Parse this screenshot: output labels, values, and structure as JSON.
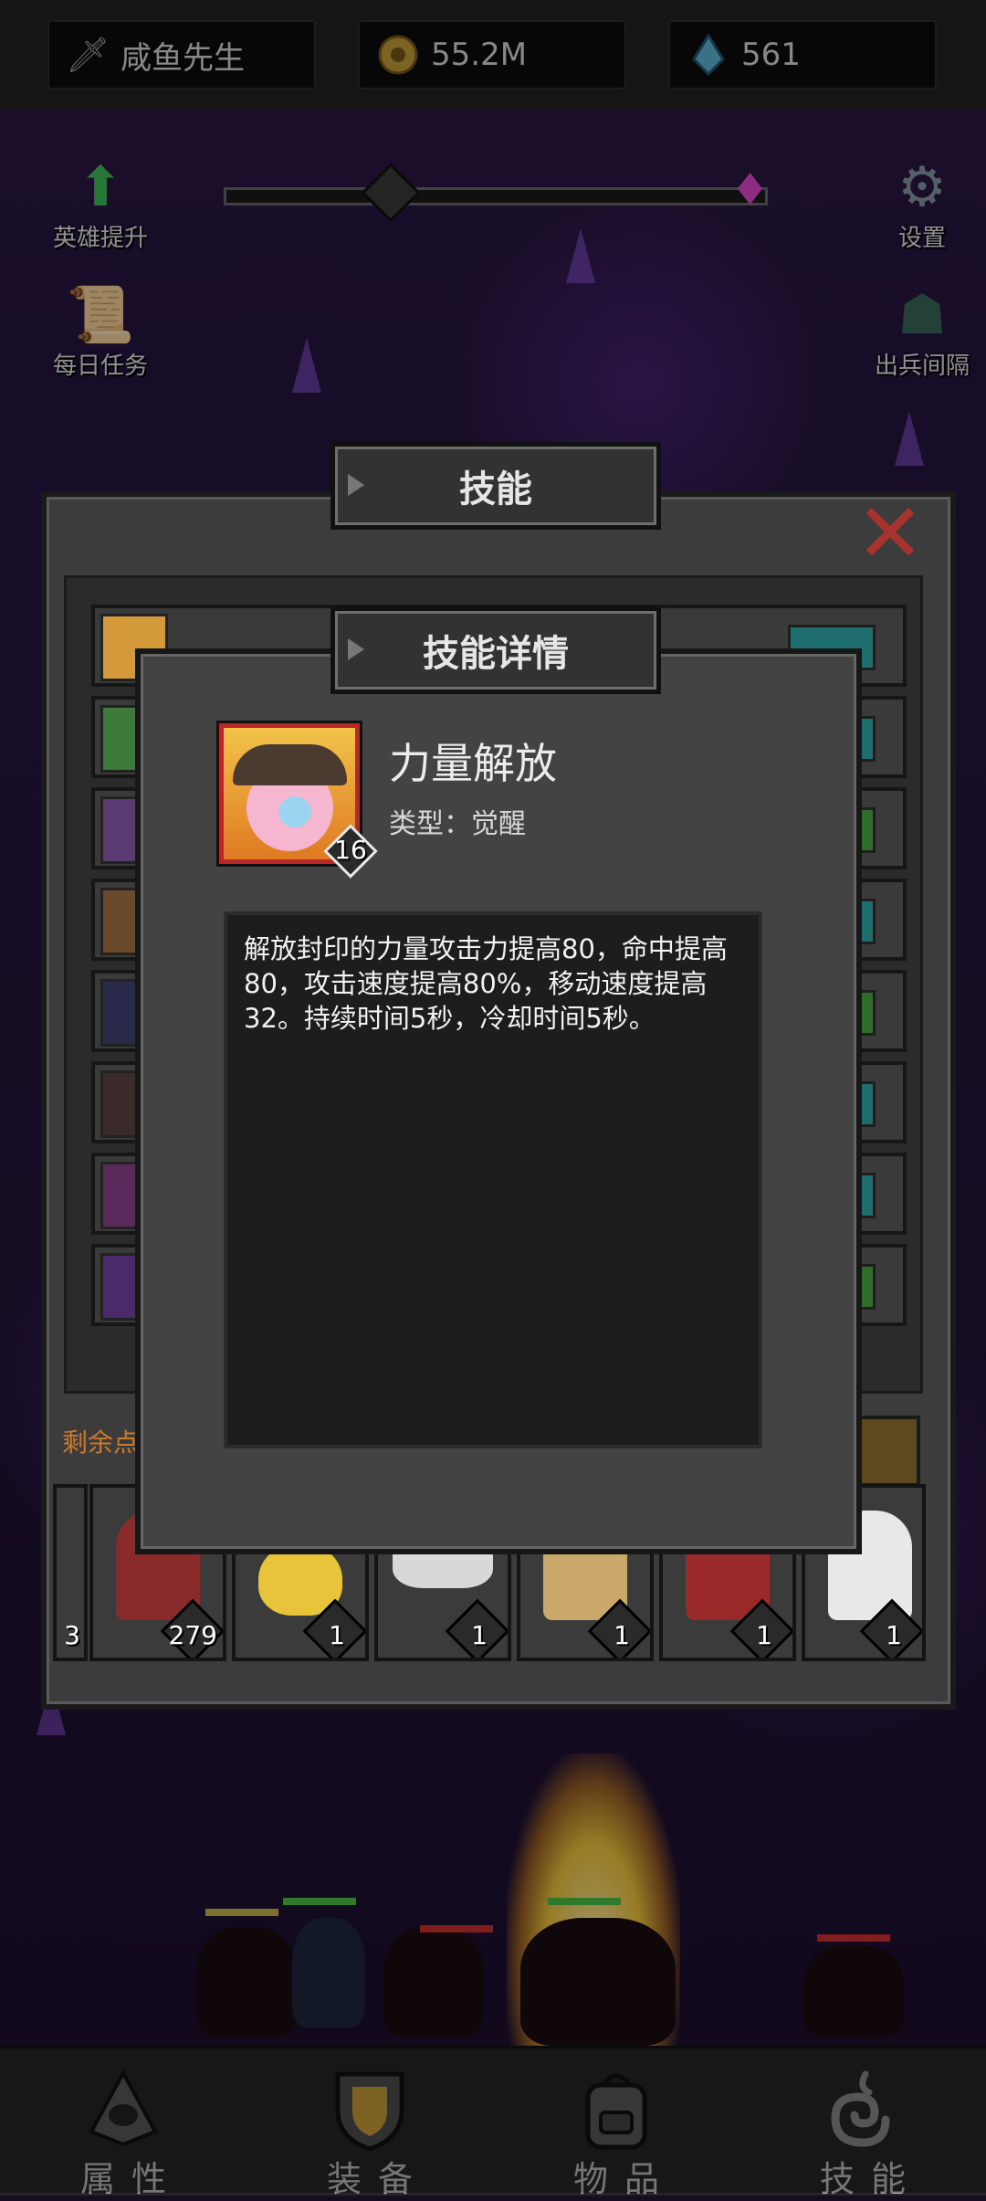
{
  "topbar": {
    "player_name": "咸鱼先生",
    "coins": "55.2M",
    "gems": "561"
  },
  "side_buttons": {
    "hero_upgrade": "英雄提升",
    "daily_tasks": "每日任务",
    "settings": "设置",
    "dispatch_interval": "出兵间隔"
  },
  "skill_panel": {
    "title": "技能",
    "remaining_points_label": "剩余点"
  },
  "hero_strip": {
    "levels": [
      "3",
      "279",
      "1",
      "1",
      "1",
      "1",
      "1"
    ]
  },
  "skill_detail": {
    "title": "技能详情",
    "name": "力量解放",
    "type": "类型：觉醒",
    "level": "16",
    "description": "解放封印的力量攻击力提高80，命中提高80，攻击速度提高80%，移动速度提高32。持续时间5秒，冷却时间5秒。"
  },
  "bottom_nav": {
    "attributes": "属性",
    "equipment": "装备",
    "items": "物品",
    "skills": "技能"
  },
  "colors": {
    "close_red": "#a8322d",
    "remaining_orange": "#c97a2a",
    "background_purple": "#2a1745"
  }
}
